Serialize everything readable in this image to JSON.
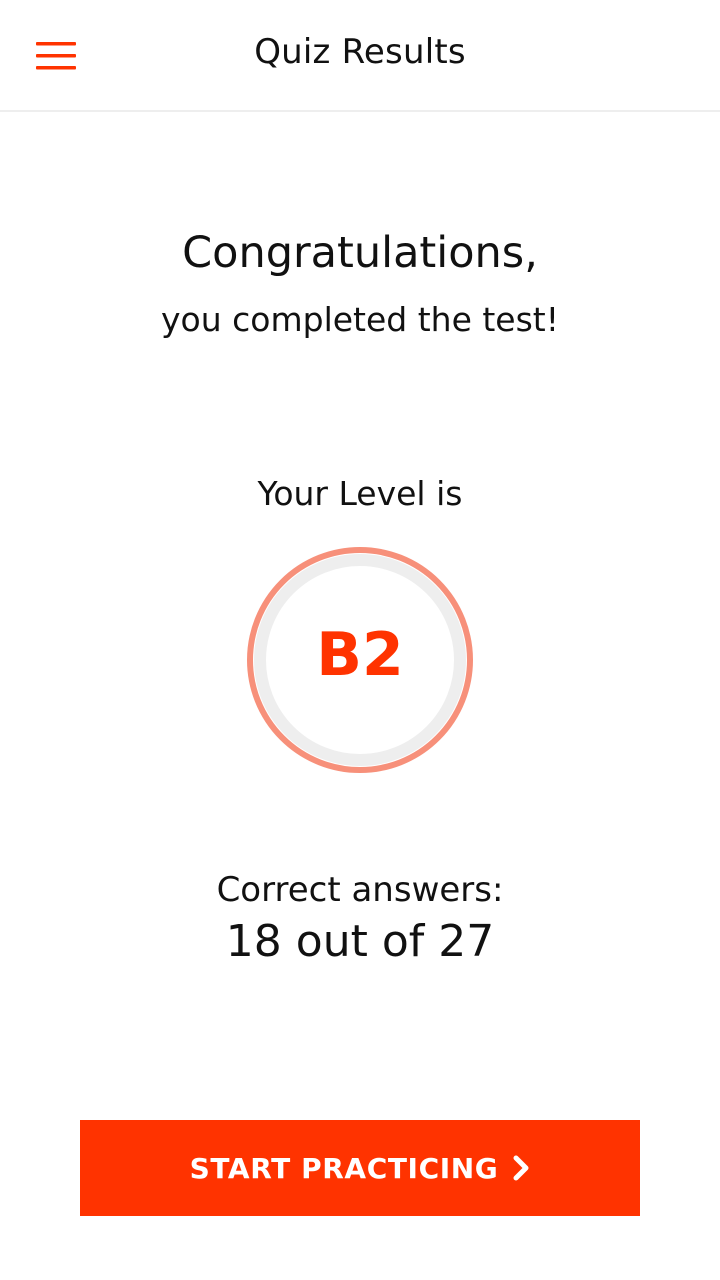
{
  "colors": {
    "accent": "#ff3300",
    "ring_outer": "#f7907a",
    "ring_inner": "#eeeeee"
  },
  "header": {
    "menu_icon": "hamburger-icon",
    "title": "Quiz Results"
  },
  "result": {
    "congrats_title": "Congratulations,",
    "congrats_subtitle": "you completed the test!",
    "level_label": "Your Level is",
    "level_value": "B2",
    "correct_label": "Correct answers:",
    "correct_value": "18 out of 27"
  },
  "cta": {
    "label": "START PRACTICING",
    "icon": "chevron-right-icon"
  }
}
